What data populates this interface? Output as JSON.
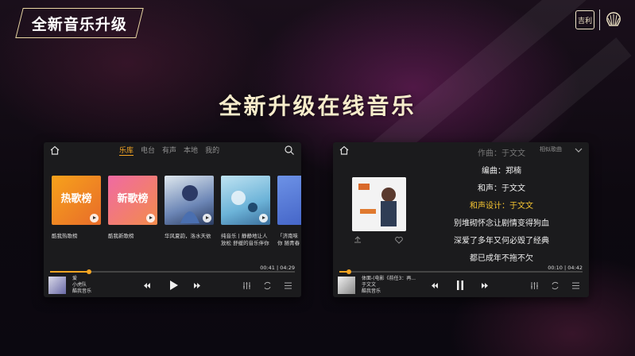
{
  "header": {
    "badge": "全新音乐升级",
    "logo_text": "吉利",
    "title": "全新升级在线音乐"
  },
  "screen1": {
    "tabs": [
      {
        "label": "乐库",
        "active": true
      },
      {
        "label": "电台",
        "active": false
      },
      {
        "label": "有声",
        "active": false
      },
      {
        "label": "本地",
        "active": false
      },
      {
        "label": "我的",
        "active": false
      }
    ],
    "cards": [
      {
        "cover_title": "热歌榜",
        "cover_sub": "",
        "caption": "酷我热歌榜"
      },
      {
        "cover_title": "新歌榜",
        "cover_sub": "",
        "caption": "酷我新歌榜"
      },
      {
        "cover_title": "",
        "cover_sub": "",
        "caption": "华风夏韵，洛水天依"
      },
      {
        "cover_title": "",
        "cover_sub": "",
        "caption": "纯音乐丨静静地让人放松 舒缓的音乐伴你入眠"
      },
      {
        "cover_title": "",
        "cover_sub": "",
        "caption": "「济南味你 随青春聊"
      }
    ],
    "progress": 0.16,
    "elapsed": "00:41",
    "total": "04:29",
    "now_playing": {
      "title": "爱",
      "artist": "小虎队",
      "source": "酷我音乐"
    }
  },
  "screen2": {
    "tabs": [
      {
        "label": "相似歌曲"
      }
    ],
    "lyrics": [
      {
        "text": "作曲：于文文",
        "state": "dim"
      },
      {
        "text": "编曲：郑楠",
        "state": "normal"
      },
      {
        "text": "和声：于文文",
        "state": "normal"
      },
      {
        "text": "和声设计：于文文",
        "state": "current"
      },
      {
        "text": "别堆砌怀念让剧情变得狗血",
        "state": "normal"
      },
      {
        "text": "深爱了多年又何必毁了经典",
        "state": "normal"
      },
      {
        "text": "都已成年不拖不欠",
        "state": "normal"
      }
    ],
    "progress": 0.04,
    "elapsed": "00:10",
    "total": "04:42",
    "now_playing": {
      "title": "体面-(电影《前任3：再...",
      "artist": "于文文",
      "source": "酷我音乐"
    }
  },
  "colors": {
    "accent": "#f5a623",
    "highlight_lyric": "#f5c431",
    "title_gold": "#f6eccb"
  },
  "icons": [
    "home-icon",
    "search-icon",
    "prev-icon",
    "play-icon",
    "pause-icon",
    "next-icon",
    "equalizer-icon",
    "repeat-icon",
    "playlist-icon",
    "chevron-down-icon",
    "heart-icon",
    "share-icon"
  ]
}
